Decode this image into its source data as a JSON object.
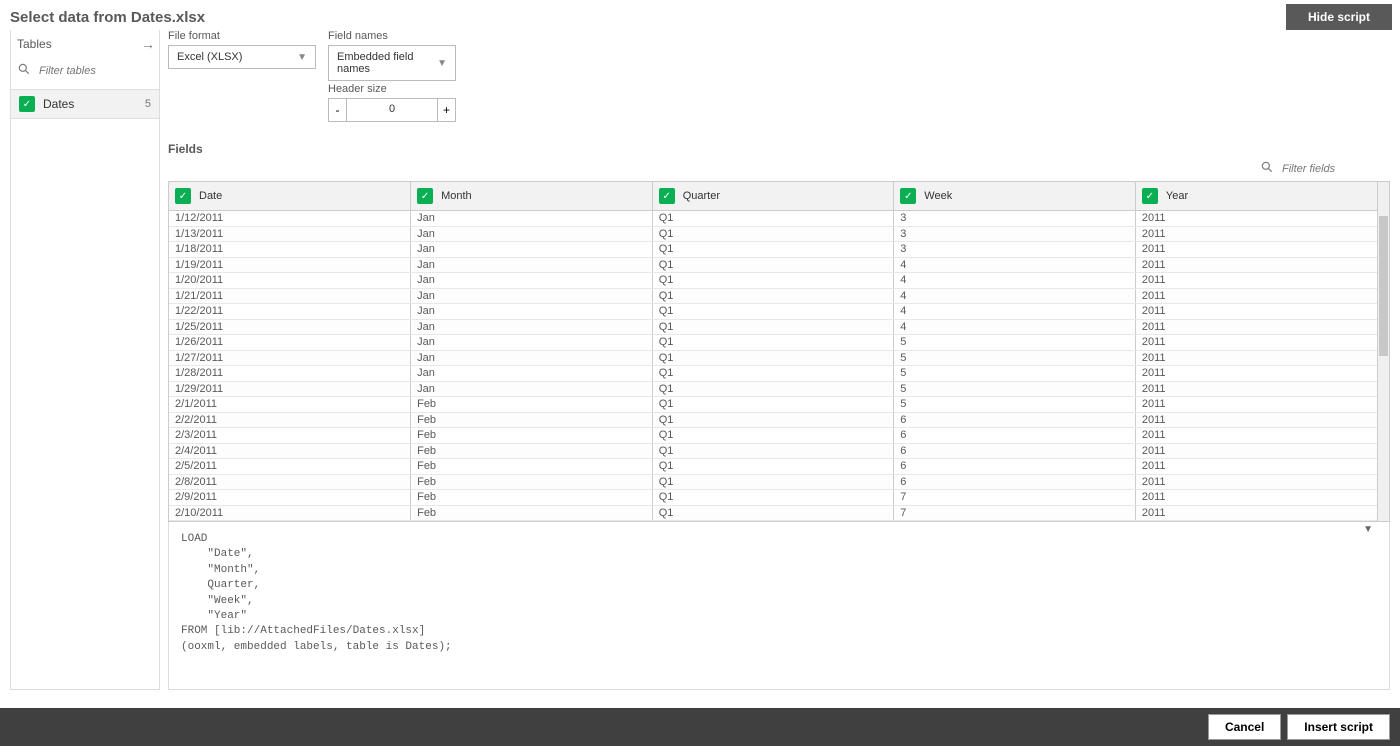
{
  "title": "Select data from Dates.xlsx",
  "hide_script_label": "Hide script",
  "left": {
    "tables_label": "Tables",
    "filter_placeholder": "Filter tables",
    "items": [
      {
        "name": "Dates",
        "count": "5"
      }
    ]
  },
  "config": {
    "file_format_label": "File format",
    "file_format_value": "Excel (XLSX)",
    "field_names_label": "Field names",
    "field_names_value": "Embedded field names",
    "header_size_label": "Header size",
    "header_size_value": "0"
  },
  "fields_label": "Fields",
  "filter_fields_placeholder": "Filter fields",
  "columns": [
    "Date",
    "Month",
    "Quarter",
    "Week",
    "Year"
  ],
  "rows": [
    [
      "1/12/2011",
      "Jan",
      "Q1",
      "3",
      "2011"
    ],
    [
      "1/13/2011",
      "Jan",
      "Q1",
      "3",
      "2011"
    ],
    [
      "1/18/2011",
      "Jan",
      "Q1",
      "3",
      "2011"
    ],
    [
      "1/19/2011",
      "Jan",
      "Q1",
      "4",
      "2011"
    ],
    [
      "1/20/2011",
      "Jan",
      "Q1",
      "4",
      "2011"
    ],
    [
      "1/21/2011",
      "Jan",
      "Q1",
      "4",
      "2011"
    ],
    [
      "1/22/2011",
      "Jan",
      "Q1",
      "4",
      "2011"
    ],
    [
      "1/25/2011",
      "Jan",
      "Q1",
      "4",
      "2011"
    ],
    [
      "1/26/2011",
      "Jan",
      "Q1",
      "5",
      "2011"
    ],
    [
      "1/27/2011",
      "Jan",
      "Q1",
      "5",
      "2011"
    ],
    [
      "1/28/2011",
      "Jan",
      "Q1",
      "5",
      "2011"
    ],
    [
      "1/29/2011",
      "Jan",
      "Q1",
      "5",
      "2011"
    ],
    [
      "2/1/2011",
      "Feb",
      "Q1",
      "5",
      "2011"
    ],
    [
      "2/2/2011",
      "Feb",
      "Q1",
      "6",
      "2011"
    ],
    [
      "2/3/2011",
      "Feb",
      "Q1",
      "6",
      "2011"
    ],
    [
      "2/4/2011",
      "Feb",
      "Q1",
      "6",
      "2011"
    ],
    [
      "2/5/2011",
      "Feb",
      "Q1",
      "6",
      "2011"
    ],
    [
      "2/8/2011",
      "Feb",
      "Q1",
      "6",
      "2011"
    ],
    [
      "2/9/2011",
      "Feb",
      "Q1",
      "7",
      "2011"
    ],
    [
      "2/10/2011",
      "Feb",
      "Q1",
      "7",
      "2011"
    ]
  ],
  "script": "LOAD\n    \"Date\",\n    \"Month\",\n    Quarter,\n    \"Week\",\n    \"Year\"\nFROM [lib://AttachedFiles/Dates.xlsx]\n(ooxml, embedded labels, table is Dates);",
  "footer": {
    "cancel": "Cancel",
    "insert": "Insert script"
  }
}
